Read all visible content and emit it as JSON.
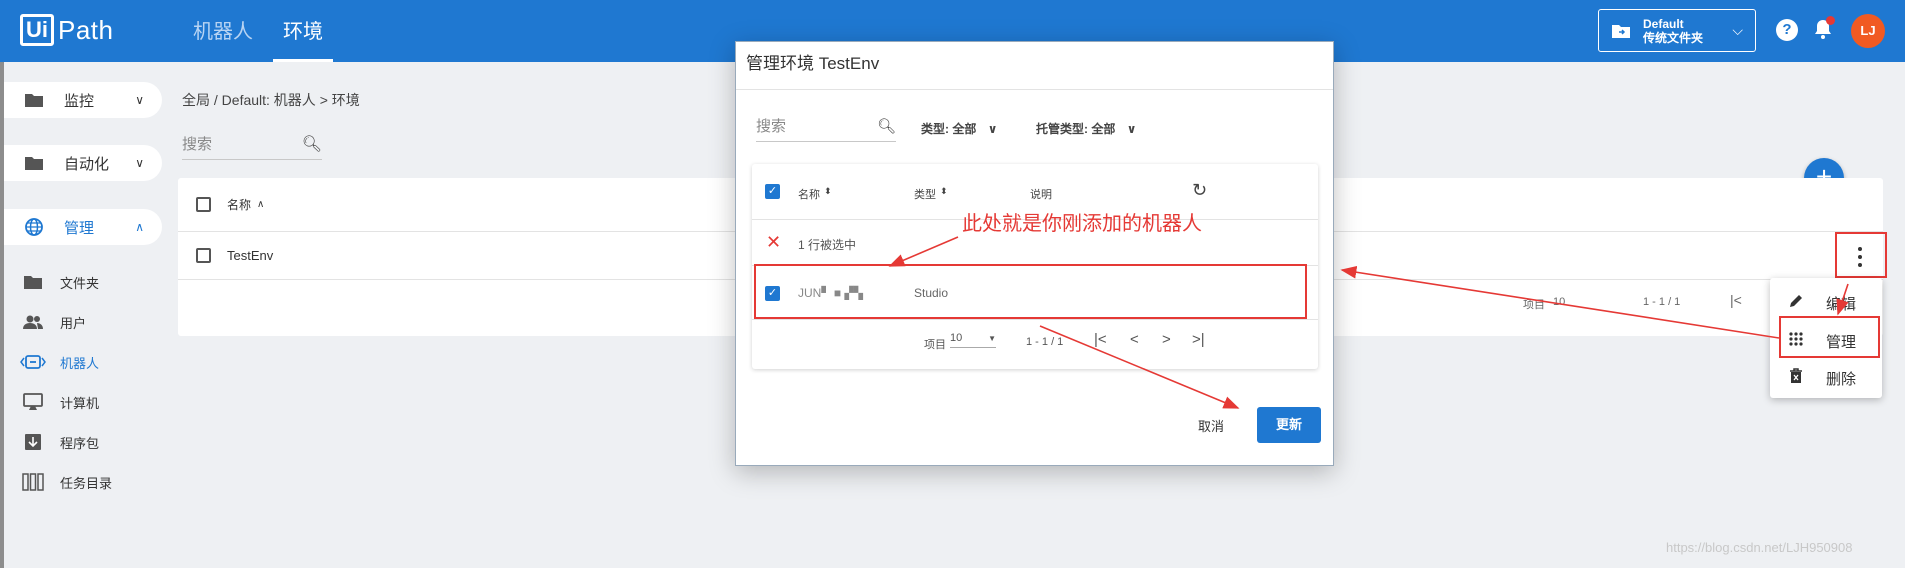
{
  "header": {
    "logo_ui": "Ui",
    "logo_path": "Path",
    "tabs": [
      {
        "label": "机器人",
        "active": false
      },
      {
        "label": "环境",
        "active": true
      }
    ],
    "folder_name": "Default",
    "folder_type": "传统文件夹",
    "help_glyph": "?",
    "avatar_initials": "LJ"
  },
  "sidebar": {
    "groups": [
      {
        "label": "监控",
        "icon": "folder-icon"
      },
      {
        "label": "自动化",
        "icon": "folder-icon"
      },
      {
        "label": "管理",
        "icon": "globe-icon",
        "active": true
      }
    ],
    "items": [
      {
        "label": "文件夹",
        "icon": "folder-icon"
      },
      {
        "label": "用户",
        "icon": "users-icon"
      },
      {
        "label": "机器人",
        "icon": "robot-icon",
        "active": true
      },
      {
        "label": "计算机",
        "icon": "computer-icon"
      },
      {
        "label": "程序包",
        "icon": "package-icon"
      },
      {
        "label": "任务目录",
        "icon": "queue-icon"
      }
    ]
  },
  "main": {
    "breadcrumb": "全局 / Default: 机器人 > 环境",
    "search_placeholder": "搜索",
    "table": {
      "column_name": "名称",
      "rows": [
        {
          "name": "TestEnv"
        }
      ],
      "pager_items_label": "项目",
      "pager_items_value": "10",
      "pager_range": "1 - 1 / 1"
    }
  },
  "dialog": {
    "title": "管理环境 TestEnv",
    "search_placeholder": "搜索",
    "filter_type": "类型: 全部",
    "filter_hosting": "托管类型: 全部",
    "columns": {
      "name": "名称",
      "type": "类型",
      "description": "说明"
    },
    "selection_text": "1 行被选中",
    "rows": [
      {
        "name": "JUN▘ ■ ▞▚",
        "type": "Studio",
        "checked": true
      }
    ],
    "pager_items_label": "项目",
    "pager_items_value": "10",
    "pager_range": "1 - 1 / 1",
    "cancel_label": "取消",
    "update_label": "更新"
  },
  "context_menu": {
    "items": [
      {
        "label": "编辑",
        "icon": "pencil-icon"
      },
      {
        "label": "管理",
        "icon": "grid-icon"
      },
      {
        "label": "删除",
        "icon": "trash-icon"
      }
    ]
  },
  "annotation": {
    "text": "此处就是你刚添加的机器人",
    "color": "#e53935"
  },
  "watermark": "https://blog.csdn.net/LJH950908",
  "colors": {
    "brand": "#1f78d1",
    "avatar": "#f15a22",
    "annotation": "#e53935"
  }
}
